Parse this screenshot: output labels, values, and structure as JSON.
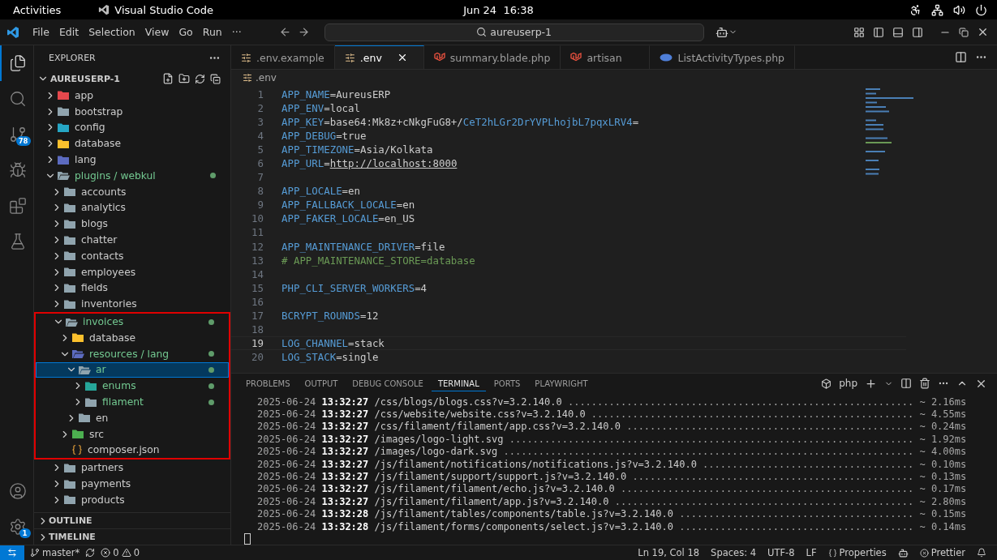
{
  "system_bar": {
    "activities": "Activities",
    "app_name": "Visual Studio Code",
    "clock": "Jun 24  16:38"
  },
  "title_bar": {
    "menu": [
      "File",
      "Edit",
      "Selection",
      "View",
      "Go",
      "Run"
    ],
    "more": "···",
    "search": "aureuserp-1"
  },
  "activity_bar": [
    {
      "kind": "explorer",
      "selected": true
    },
    {
      "kind": "search",
      "selected": false
    },
    {
      "kind": "source-control",
      "selected": false,
      "badge": "78"
    },
    {
      "kind": "debug",
      "selected": false
    },
    {
      "kind": "extensions",
      "selected": false
    },
    {
      "kind": "testing",
      "selected": false
    }
  ],
  "activity_bottom": [
    {
      "kind": "account"
    },
    {
      "kind": "settings",
      "badge": "1"
    }
  ],
  "sidebar": {
    "title": "EXPLORER",
    "root": "AUREUSERP-1",
    "root_expanded": true,
    "tree": [
      {
        "name": "app",
        "kind": "app",
        "expanded": false,
        "modified": false,
        "selected": false
      },
      {
        "name": "bootstrap",
        "kind": "folder",
        "expanded": false,
        "modified": false,
        "selected": false
      },
      {
        "name": "config",
        "kind": "config",
        "expanded": false,
        "modified": false,
        "selected": false
      },
      {
        "name": "database",
        "kind": "database",
        "expanded": false,
        "modified": false,
        "selected": false
      },
      {
        "name": "lang",
        "kind": "lang",
        "expanded": false,
        "modified": false,
        "selected": false
      },
      {
        "name": "plugins / webkul",
        "kind": "folder",
        "expanded": true,
        "modified": true,
        "selected": false,
        "children": [
          {
            "name": "accounts",
            "kind": "folder",
            "expanded": false,
            "modified": false,
            "selected": false
          },
          {
            "name": "analytics",
            "kind": "folder",
            "expanded": false,
            "modified": false,
            "selected": false
          },
          {
            "name": "blogs",
            "kind": "folder",
            "expanded": false,
            "modified": false,
            "selected": false
          },
          {
            "name": "chatter",
            "kind": "folder",
            "expanded": false,
            "modified": false,
            "selected": false
          },
          {
            "name": "contacts",
            "kind": "folder",
            "expanded": false,
            "modified": false,
            "selected": false
          },
          {
            "name": "employees",
            "kind": "folder",
            "expanded": false,
            "modified": false,
            "selected": false
          },
          {
            "name": "fields",
            "kind": "folder",
            "expanded": false,
            "modified": false,
            "selected": false
          },
          {
            "name": "inventories",
            "kind": "folder",
            "expanded": false,
            "modified": false,
            "selected": false
          },
          {
            "name": "invoices",
            "kind": "folder",
            "expanded": true,
            "modified": true,
            "selected": false,
            "highlighted": true,
            "children": [
              {
                "name": "database",
                "kind": "database",
                "expanded": false,
                "modified": false,
                "selected": false
              },
              {
                "name": "resources / lang",
                "kind": "lang",
                "expanded": true,
                "modified": true,
                "selected": false,
                "children": [
                  {
                    "name": "ar",
                    "kind": "folder",
                    "expanded": true,
                    "modified": true,
                    "selected": true,
                    "children": [
                      {
                        "name": "enums",
                        "kind": "enums",
                        "expanded": false,
                        "modified": true,
                        "selected": false
                      },
                      {
                        "name": "filament",
                        "kind": "folder",
                        "expanded": false,
                        "modified": true,
                        "selected": false
                      }
                    ]
                  },
                  {
                    "name": "en",
                    "kind": "folder",
                    "expanded": false,
                    "modified": false,
                    "selected": false
                  }
                ]
              },
              {
                "name": "src",
                "kind": "src",
                "expanded": false,
                "modified": false,
                "selected": false
              },
              {
                "name": "composer.json",
                "kind": "json",
                "modified": false,
                "selected": false
              }
            ]
          },
          {
            "name": "partners",
            "kind": "folder",
            "expanded": false,
            "modified": false,
            "selected": false
          },
          {
            "name": "payments",
            "kind": "folder",
            "expanded": false,
            "modified": false,
            "selected": false
          },
          {
            "name": "products",
            "kind": "folder",
            "expanded": false,
            "modified": false,
            "selected": false
          }
        ]
      }
    ],
    "sections": [
      "OUTLINE",
      "TIMELINE"
    ]
  },
  "tabs": [
    {
      "label": ".env.example",
      "kind": "env",
      "selected": false
    },
    {
      "label": ".env",
      "kind": "env",
      "selected": true
    },
    {
      "label": "summary.blade.php",
      "kind": "laravel",
      "selected": false
    },
    {
      "label": "artisan",
      "kind": "laravel",
      "selected": false
    },
    {
      "label": "ListActivityTypes.php",
      "kind": "php",
      "selected": false
    }
  ],
  "breadcrumb": ".env",
  "code": [
    {
      "number": "1",
      "current": false,
      "segments": [
        {
          "kind": "key",
          "text": "APP_NAME"
        },
        {
          "kind": "text",
          "text": "=AureusERP"
        }
      ]
    },
    {
      "number": "2",
      "current": false,
      "segments": [
        {
          "kind": "key",
          "text": "APP_ENV"
        },
        {
          "kind": "text",
          "text": "=local"
        }
      ]
    },
    {
      "number": "3",
      "current": false,
      "segments": [
        {
          "kind": "key",
          "text": "APP_KEY"
        },
        {
          "kind": "text",
          "text": "=base64:Mk8z+cNkgFuG8+/"
        },
        {
          "kind": "accent",
          "text": "CeT2hLGr2DrYVPLhojbL7pqxLRV4"
        },
        {
          "kind": "text",
          "text": "="
        }
      ]
    },
    {
      "number": "4",
      "current": false,
      "segments": [
        {
          "kind": "key",
          "text": "APP_DEBUG"
        },
        {
          "kind": "text",
          "text": "=true"
        }
      ]
    },
    {
      "number": "5",
      "current": false,
      "segments": [
        {
          "kind": "key",
          "text": "APP_TIMEZONE"
        },
        {
          "kind": "text",
          "text": "=Asia/Kolkata"
        }
      ]
    },
    {
      "number": "6",
      "current": false,
      "segments": [
        {
          "kind": "key",
          "text": "APP_URL"
        },
        {
          "kind": "text",
          "text": "="
        },
        {
          "kind": "link",
          "text": "http://localhost:8000"
        }
      ]
    },
    {
      "number": "7",
      "current": false
    },
    {
      "number": "8",
      "current": false,
      "segments": [
        {
          "kind": "key",
          "text": "APP_LOCALE"
        },
        {
          "kind": "text",
          "text": "=en"
        }
      ]
    },
    {
      "number": "9",
      "current": false,
      "segments": [
        {
          "kind": "key",
          "text": "APP_FALLBACK_LOCALE"
        },
        {
          "kind": "text",
          "text": "=en"
        }
      ]
    },
    {
      "number": "10",
      "current": false,
      "segments": [
        {
          "kind": "key",
          "text": "APP_FAKER_LOCALE"
        },
        {
          "kind": "text",
          "text": "=en_US"
        }
      ]
    },
    {
      "number": "11",
      "current": false
    },
    {
      "number": "12",
      "current": false,
      "segments": [
        {
          "kind": "key",
          "text": "APP_MAINTENANCE_DRIVER"
        },
        {
          "kind": "text",
          "text": "=file"
        }
      ]
    },
    {
      "number": "13",
      "current": false,
      "segments": [
        {
          "kind": "comment",
          "text": "# APP_MAINTENANCE_STORE=database"
        }
      ]
    },
    {
      "number": "14",
      "current": false
    },
    {
      "number": "15",
      "current": false,
      "segments": [
        {
          "kind": "key",
          "text": "PHP_CLI_SERVER_WORKERS"
        },
        {
          "kind": "text",
          "text": "=4"
        }
      ]
    },
    {
      "number": "16",
      "current": false
    },
    {
      "number": "17",
      "current": false,
      "segments": [
        {
          "kind": "key",
          "text": "BCRYPT_ROUNDS"
        },
        {
          "kind": "text",
          "text": "=12"
        }
      ]
    },
    {
      "number": "18",
      "current": false
    },
    {
      "number": "19",
      "current": true,
      "segments": [
        {
          "kind": "key",
          "text": "LOG_CHANNEL"
        },
        {
          "kind": "text",
          "text": "=stack"
        }
      ]
    },
    {
      "number": "20",
      "current": false,
      "segments": [
        {
          "kind": "key",
          "text": "LOG_STACK"
        },
        {
          "kind": "text",
          "text": "=single"
        }
      ]
    }
  ],
  "panel": {
    "tabs": [
      {
        "label": "PROBLEMS",
        "selected": false
      },
      {
        "label": "OUTPUT",
        "selected": false
      },
      {
        "label": "DEBUG CONSOLE",
        "selected": false
      },
      {
        "label": "TERMINAL",
        "selected": true
      },
      {
        "label": "PORTS",
        "selected": false
      },
      {
        "label": "PLAYWRIGHT",
        "selected": false
      }
    ],
    "terminal_name": "php",
    "lines": [
      {
        "date": "2025-06-24",
        "time": "13:32:27",
        "path": "/css/blogs/blogs.css?v=3.2.140.0",
        "dots": "...........................................................",
        "duration": "~ 2.16ms"
      },
      {
        "date": "2025-06-24",
        "time": "13:32:27",
        "path": "/css/website/website.css?v=3.2.140.0",
        "dots": ".......................................................",
        "duration": "~ 4.55ms"
      },
      {
        "date": "2025-06-24",
        "time": "13:32:27",
        "path": "/css/filament/filament/app.css?v=3.2.140.0",
        "dots": ".................................................",
        "duration": "~ 0.24ms"
      },
      {
        "date": "2025-06-24",
        "time": "13:32:27",
        "path": "/images/logo-light.svg",
        "dots": ".....................................................................",
        "duration": "~ 1.92ms"
      },
      {
        "date": "2025-06-24",
        "time": "13:32:27",
        "path": "/images/logo-dark.svg",
        "dots": "......................................................................",
        "duration": "~ 4.00ms"
      },
      {
        "date": "2025-06-24",
        "time": "13:32:27",
        "path": "/js/filament/notifications/notifications.js?v=3.2.140.0",
        "dots": "....................................",
        "duration": "~ 0.10ms"
      },
      {
        "date": "2025-06-24",
        "time": "13:32:27",
        "path": "/js/filament/support/support.js?v=3.2.140.0",
        "dots": "................................................",
        "duration": "~ 0.13ms"
      },
      {
        "date": "2025-06-24",
        "time": "13:32:27",
        "path": "/js/filament/filament/echo.js?v=3.2.140.0",
        "dots": "..................................................",
        "duration": "~ 0.17ms"
      },
      {
        "date": "2025-06-24",
        "time": "13:32:27",
        "path": "/js/filament/filament/app.js?v=3.2.140.0",
        "dots": "...................................................",
        "duration": "~ 2.80ms"
      },
      {
        "date": "2025-06-24",
        "time": "13:32:28",
        "path": "/js/filament/tables/components/table.js?v=3.2.140.0",
        "dots": "........................................",
        "duration": "~ 0.15ms"
      },
      {
        "date": "2025-06-24",
        "time": "13:32:28",
        "path": "/js/filament/forms/components/select.js?v=3.2.140.0",
        "dots": "........................................",
        "duration": "~ 0.14ms"
      }
    ]
  },
  "status_bar": {
    "branch": "master*",
    "errors": "0",
    "warnings": "0",
    "position": "Ln 19, Col 18",
    "indent": "Spaces: 4",
    "encoding": "UTF-8",
    "eol": "LF",
    "language": "Properties",
    "formatter": "Prettier"
  }
}
